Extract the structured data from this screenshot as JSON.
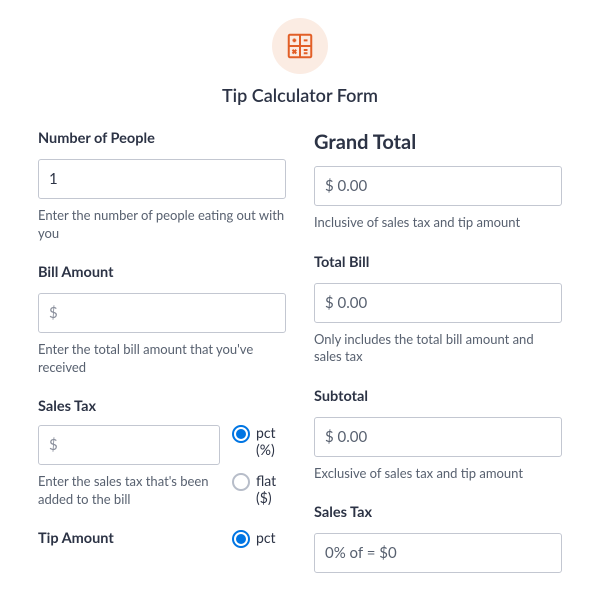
{
  "header": {
    "title": "Tip Calculator Form",
    "icon": "calculator-icon"
  },
  "left": {
    "people": {
      "label": "Number of People",
      "value": "1",
      "help": "Enter the number of people eating out with you"
    },
    "bill": {
      "label": "Bill Amount",
      "placeholder": "$",
      "help": "Enter the total bill amount that you've received"
    },
    "salesTax": {
      "label": "Sales Tax",
      "placeholder": "$",
      "help": "Enter the sales tax that's been added to the bill",
      "options": {
        "pct": "pct (%)",
        "flat": "flat ($)"
      }
    },
    "tip": {
      "label": "Tip Amount",
      "options": {
        "pct": "pct"
      }
    }
  },
  "right": {
    "grandTotal": {
      "label": "Grand Total",
      "value": "$ 0.00",
      "help": "Inclusive of sales tax and tip amount"
    },
    "totalBill": {
      "label": "Total Bill",
      "value": "$ 0.00",
      "help": "Only includes the total bill amount and sales tax"
    },
    "subtotal": {
      "label": "Subtotal",
      "value": "$ 0.00",
      "help": "Exclusive of sales tax and tip amount"
    },
    "salesTax": {
      "label": "Sales Tax",
      "value": "0% of = $0"
    }
  }
}
